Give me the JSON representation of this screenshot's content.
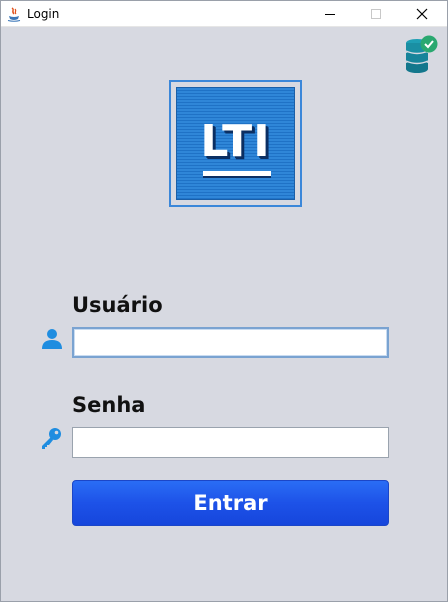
{
  "window": {
    "title": "Login",
    "icon": "java-icon",
    "controls": [
      "minimize-icon",
      "maximize-icon",
      "close-icon"
    ]
  },
  "status": {
    "icon": "database-connected-icon",
    "accent": "#2aa870"
  },
  "logo": {
    "text": "LTI",
    "color": "#2f86d8"
  },
  "form": {
    "username": {
      "label": "Usuário",
      "icon": "user-icon",
      "value": "",
      "placeholder": ""
    },
    "password": {
      "label": "Senha",
      "icon": "key-icon",
      "value": "",
      "placeholder": ""
    },
    "submit_label": "Entrar",
    "submit_color": "#1d52e8"
  }
}
